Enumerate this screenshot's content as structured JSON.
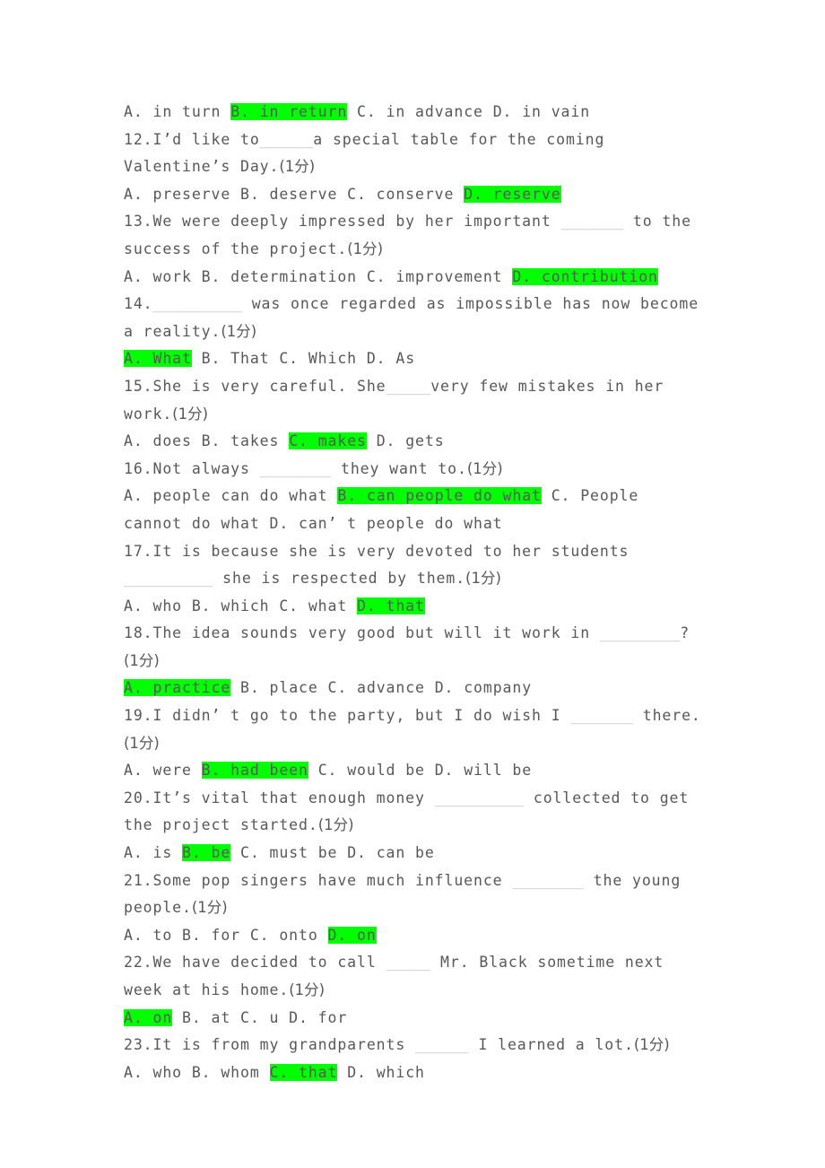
{
  "document": {
    "type": "english-grammar-multiple-choice-exam",
    "highlight_color": "#00ff00",
    "text_color": "#585858",
    "blank_color": "#b9b9b9",
    "point_marker": "(1分)",
    "lines": [
      {
        "id": "q11-options",
        "segments": [
          {
            "text": "A. in turn "
          },
          {
            "text": "B. in return",
            "highlight": true
          },
          {
            "text": " C. in advance D. in vain"
          }
        ]
      },
      {
        "id": "q12-stem",
        "segments": [
          {
            "text": "12.I’d like to"
          },
          {
            "text": "______",
            "blank": true
          },
          {
            "text": "a special table for the coming Valentine’s Day."
          },
          {
            "text": "(1分)",
            "cjk": true
          }
        ]
      },
      {
        "id": "q12-options",
        "segments": [
          {
            "text": "A. preserve B. deserve C. conserve "
          },
          {
            "text": "D. reserve",
            "highlight": true
          }
        ]
      },
      {
        "id": "q13-stem",
        "segments": [
          {
            "text": "13.We were deeply impressed by her important "
          },
          {
            "text": "_______",
            "blank": true
          },
          {
            "text": " to the success of the project."
          },
          {
            "text": "(1分)",
            "cjk": true
          }
        ]
      },
      {
        "id": "q13-options",
        "segments": [
          {
            "text": "A. work B. determination C. improvement "
          },
          {
            "text": "D. contribution",
            "highlight": true
          }
        ]
      },
      {
        "id": "q14-stem",
        "segments": [
          {
            "text": "14."
          },
          {
            "text": "__________",
            "blank": true
          },
          {
            "text": " was once regarded as impossible has now become a reality."
          },
          {
            "text": "(1分)",
            "cjk": true
          }
        ]
      },
      {
        "id": "q14-options",
        "segments": [
          {
            "text": "A. What",
            "highlight": true
          },
          {
            "text": " B. That C. Which D. As"
          }
        ]
      },
      {
        "id": "q15-stem",
        "segments": [
          {
            "text": "15.She is very careful. She"
          },
          {
            "text": "_____",
            "blank": true
          },
          {
            "text": "very few mistakes in her work."
          },
          {
            "text": "(1分)",
            "cjk": true
          }
        ]
      },
      {
        "id": "q15-options",
        "segments": [
          {
            "text": "A. does B. takes "
          },
          {
            "text": "C. makes",
            "highlight": true
          },
          {
            "text": " D. gets"
          }
        ]
      },
      {
        "id": "q16-stem",
        "segments": [
          {
            "text": "16.Not always "
          },
          {
            "text": "________",
            "blank": true
          },
          {
            "text": " they want to."
          },
          {
            "text": "(1分)",
            "cjk": true
          }
        ]
      },
      {
        "id": "q16-options",
        "segments": [
          {
            "text": "A. people can do what "
          },
          {
            "text": "B. can people do what",
            "highlight": true
          },
          {
            "text": " C. People cannot do what D. can’ t people do what"
          }
        ]
      },
      {
        "id": "q17-stem",
        "segments": [
          {
            "text": "17.It is because she is very devoted to her students "
          },
          {
            "text": "__________",
            "blank": true
          },
          {
            "text": " she is respected by them."
          },
          {
            "text": "(1分)",
            "cjk": true
          }
        ]
      },
      {
        "id": "q17-options",
        "segments": [
          {
            "text": "A. who B. which C. what "
          },
          {
            "text": "D. that",
            "highlight": true
          }
        ]
      },
      {
        "id": "q18-stem",
        "segments": [
          {
            "text": "18.The idea sounds very good but will it work in "
          },
          {
            "text": "_________",
            "blank": true
          },
          {
            "text": "?"
          },
          {
            "text": "(1分)",
            "cjk": true
          }
        ]
      },
      {
        "id": "q18-options",
        "segments": [
          {
            "text": "A. practice",
            "highlight": true
          },
          {
            "text": " B. place C. advance D. company"
          }
        ]
      },
      {
        "id": "q19-stem",
        "segments": [
          {
            "text": "19.I didn’ t go to the party, but I do wish I "
          },
          {
            "text": "_______",
            "blank": true
          },
          {
            "text": " there."
          },
          {
            "text": "(1分)",
            "cjk": true
          }
        ]
      },
      {
        "id": "q19-options",
        "segments": [
          {
            "text": "A. were "
          },
          {
            "text": "B. had been",
            "highlight": true
          },
          {
            "text": " C. would be D. will be"
          }
        ]
      },
      {
        "id": "q20-stem",
        "segments": [
          {
            "text": "20.It’s vital that enough money "
          },
          {
            "text": "__________",
            "blank": true
          },
          {
            "text": " collected to get the project started."
          },
          {
            "text": "(1分)",
            "cjk": true
          }
        ]
      },
      {
        "id": "q20-options",
        "segments": [
          {
            "text": "A. is "
          },
          {
            "text": "B. be",
            "highlight": true
          },
          {
            "text": " C. must be D. can be"
          }
        ]
      },
      {
        "id": "q21-stem",
        "segments": [
          {
            "text": "21.Some pop singers have much influence "
          },
          {
            "text": "________",
            "blank": true
          },
          {
            "text": " the young people."
          },
          {
            "text": "(1分)",
            "cjk": true
          }
        ]
      },
      {
        "id": "q21-options",
        "segments": [
          {
            "text": "A. to B. for C. onto "
          },
          {
            "text": "D. on",
            "highlight": true
          }
        ]
      },
      {
        "id": "q22-stem",
        "segments": [
          {
            "text": "22.We have decided to call "
          },
          {
            "text": "_____",
            "blank": true
          },
          {
            "text": " Mr. Black sometime next week at his home."
          },
          {
            "text": "(1分)",
            "cjk": true
          }
        ]
      },
      {
        "id": "q22-options",
        "segments": [
          {
            "text": "A. on",
            "highlight": true
          },
          {
            "text": " B. at C. u D. for"
          }
        ]
      },
      {
        "id": "q23-stem",
        "segments": [
          {
            "text": "23.It is from my grandparents "
          },
          {
            "text": "______",
            "blank": true
          },
          {
            "text": " I learned a lot."
          },
          {
            "text": "(1分)",
            "cjk": true
          }
        ]
      },
      {
        "id": "q23-options",
        "segments": [
          {
            "text": "A. who B. whom "
          },
          {
            "text": "C. that",
            "highlight": true
          },
          {
            "text": " D. which"
          }
        ]
      }
    ]
  }
}
